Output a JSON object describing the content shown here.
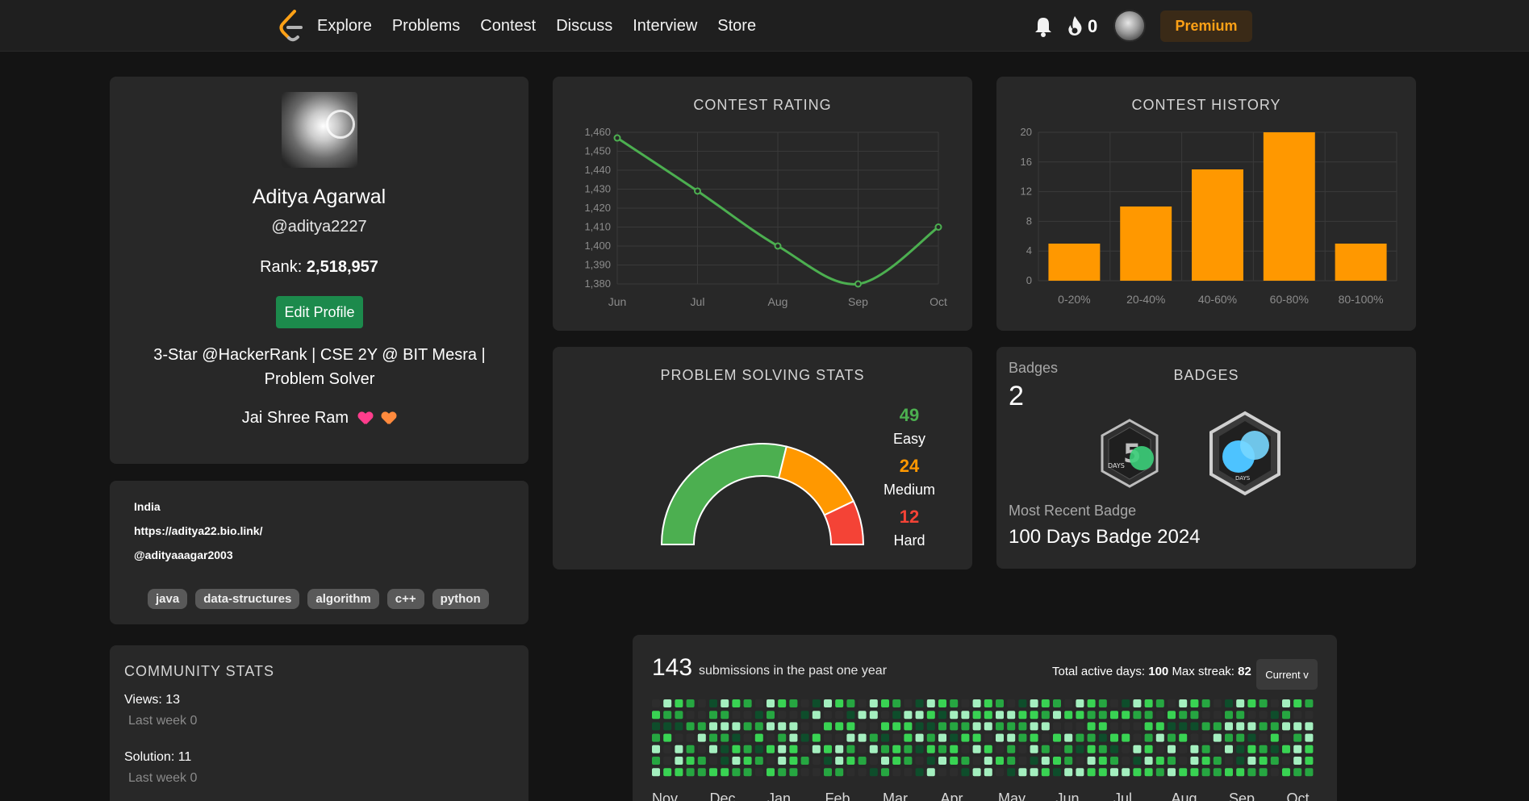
{
  "nav": {
    "links": [
      "Explore",
      "Problems",
      "Contest",
      "Discuss",
      "Interview",
      "Store"
    ],
    "streak_count": "0",
    "premium_label": "Premium"
  },
  "profile": {
    "name": "Aditya Agarwal",
    "username": "@aditya2227",
    "rank_label": "Rank:",
    "rank_value": "2,518,957",
    "edit_label": "Edit Profile",
    "bio": "3-Star @HackerRank | CSE 2Y @ BIT Mesra | Problem Solver",
    "motto": "Jai Shree Ram"
  },
  "info": {
    "location": "India",
    "website": "https://aditya22.bio.link/",
    "social": "@adityaaagar2003",
    "tags": [
      "java",
      "data-structures",
      "algorithm",
      "c++",
      "python"
    ]
  },
  "community": {
    "title": "COMMUNITY STATS",
    "views": "Views: 13",
    "views_week": "Last week 0",
    "solution": "Solution: 11",
    "solution_week": "Last week 0"
  },
  "contest_rating": {
    "title": "CONTEST RATING",
    "chart_data": {
      "type": "line",
      "title": "CONTEST RATING",
      "x": [
        "Jun",
        "Jul",
        "Aug",
        "Sep",
        "Oct"
      ],
      "values": [
        1457,
        1429,
        1400,
        1380,
        1410
      ],
      "ylim": [
        1380,
        1460
      ],
      "yticks": [
        "1,460",
        "1,450",
        "1,440",
        "1,430",
        "1,420",
        "1,410",
        "1,400",
        "1,390",
        "1,380"
      ],
      "grid": true,
      "color": "#4caf50"
    }
  },
  "contest_history": {
    "title": "CONTEST HISTORY",
    "chart_data": {
      "type": "bar",
      "title": "CONTEST HISTORY",
      "categories": [
        "0-20%",
        "20-40%",
        "40-60%",
        "60-80%",
        "80-100%"
      ],
      "values": [
        5,
        10,
        15,
        20,
        5
      ],
      "ylim": [
        0,
        20
      ],
      "yticks": [
        "20",
        "16",
        "12",
        "8",
        "4",
        "0"
      ],
      "grid": true,
      "color": "#ff9800"
    }
  },
  "problem_stats": {
    "title": "PROBLEM SOLVING STATS",
    "easy_count": "49",
    "easy_label": "Easy",
    "medium_count": "24",
    "medium_label": "Medium",
    "hard_count": "12",
    "hard_label": "Hard",
    "colors": {
      "easy": "#4caf50",
      "medium": "#ff9800",
      "hard": "#f44336"
    }
  },
  "badges": {
    "label": "Badges",
    "title": "BADGES",
    "count": "2",
    "badge1_text": "DAYS",
    "badge2_text": "DAYS",
    "recent_label": "Most Recent Badge",
    "recent_name": "100 Days Badge 2024"
  },
  "submissions": {
    "count": "143",
    "text": "submissions in the past one year",
    "active_label": "Total active days:",
    "active_days": "100",
    "streak_label": "Max streak:",
    "max_streak": "82",
    "current_label": "Current v",
    "months": [
      "Nov",
      "Dec",
      "Jan",
      "Feb",
      "Mar",
      "Apr",
      "May",
      "Jun",
      "Jul",
      "Aug",
      "Sep",
      "Oct"
    ]
  }
}
